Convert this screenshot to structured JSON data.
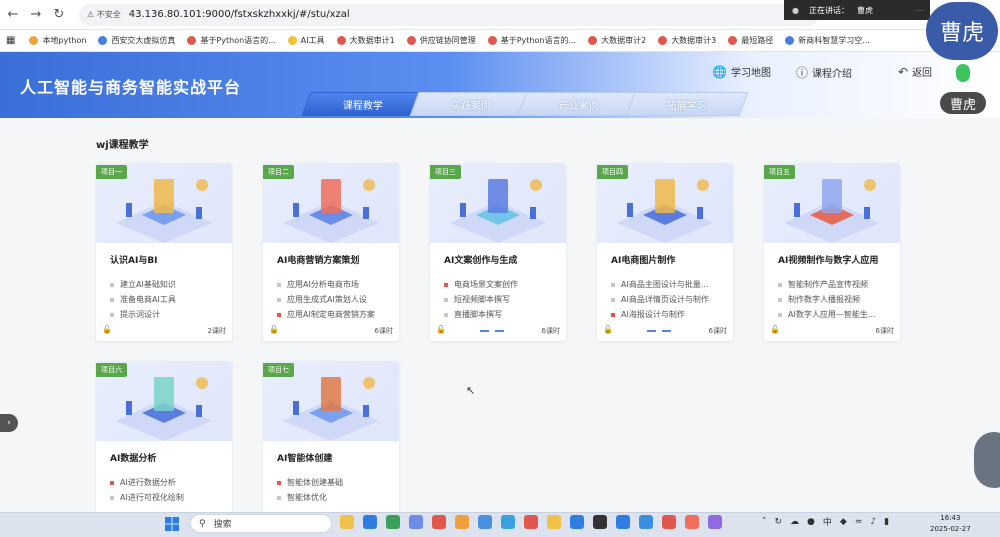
{
  "browser": {
    "security_label": "不安全",
    "url": "43.136.80.101:9000/fstxskzhxxkj/#/stu/xzal",
    "bookmarks": [
      "本地python",
      "西安交大虚拟仿真",
      "基于Python语言的...",
      "AI工具",
      "大数据审计1",
      "供应链协同管理",
      "基于Python语言的...",
      "大数据审计2",
      "大数据审计3",
      "最短路径",
      "新商科智慧学习空..."
    ]
  },
  "notification": {
    "text": "正在讲话：",
    "speaker": "曹虎"
  },
  "meeting": {
    "avatar_big": "曹虎",
    "avatar_small": "曹虎"
  },
  "header": {
    "title": "人工智能与商务智能实战平台",
    "nav": [
      {
        "label": "学习地图",
        "icon": "globe-icon"
      },
      {
        "label": "课程介绍",
        "icon": "info-icon"
      },
      {
        "label": "返回",
        "icon": "back-icon"
      }
    ]
  },
  "tabs": [
    "课程教学",
    "实践案例",
    "产业案例",
    "拓展学习"
  ],
  "active_tab": 0,
  "section_title": "wj课程教学",
  "courses": [
    {
      "tag": "项目一",
      "title": "认识AI与BI",
      "items": [
        "建立AI基础知识",
        "准备电商AI工具",
        "提示词设计"
      ],
      "hours": "2课时",
      "item_colors": [
        "#bfc7d6",
        "#bfc7d6",
        "#bfc7d6"
      ],
      "dots": false
    },
    {
      "tag": "项目二",
      "title": "AI电商营销方案策划",
      "items": [
        "应用AI分析电商市场",
        "应用生成式AI策划人设",
        "应用AI制定电商营销方案"
      ],
      "hours": "6课时",
      "item_colors": [
        "#bfc7d6",
        "#bfc7d6",
        "#e0584d"
      ],
      "dots": false
    },
    {
      "tag": "项目三",
      "title": "AI文案创作与生成",
      "items": [
        "电商场景文案创作",
        "短视频脚本撰写",
        "直播脚本撰写"
      ],
      "hours": "6课时",
      "item_colors": [
        "#e0584d",
        "#bfc7d6",
        "#bfc7d6"
      ],
      "dots": true
    },
    {
      "tag": "项目四",
      "title": "AI电商图片制作",
      "items": [
        "AI商品主图设计与批量...",
        "AI商品详情页设计与制作",
        "AI海报设计与制作"
      ],
      "hours": "6课时",
      "item_colors": [
        "#bfc7d6",
        "#bfc7d6",
        "#e0584d"
      ],
      "dots": true
    },
    {
      "tag": "项目五",
      "title": "AI视频制作与数字人应用",
      "items": [
        "智能制作产品宣传视频",
        "制作数字人播报视频",
        "AI数字人应用—智能生..."
      ],
      "hours": "6课时",
      "item_colors": [
        "#bfc7d6",
        "#bfc7d6",
        "#bfc7d6"
      ],
      "dots": false
    },
    {
      "tag": "项目六",
      "title": "AI数据分析",
      "items": [
        "AI进行数据分析",
        "AI进行可视化绘制"
      ],
      "hours": "",
      "item_colors": [
        "#e0584d",
        "#bfc7d6"
      ],
      "dots": false
    },
    {
      "tag": "项目七",
      "title": "AI智能体创建",
      "items": [
        "智能体创建基础",
        "智能体优化"
      ],
      "hours": "",
      "item_colors": [
        "#e0584d",
        "#bfc7d6"
      ],
      "dots": false
    }
  ],
  "taskbar": {
    "search_placeholder": "搜索",
    "time": "16:43",
    "date": "2025-02-27",
    "tray_lang": "中"
  }
}
